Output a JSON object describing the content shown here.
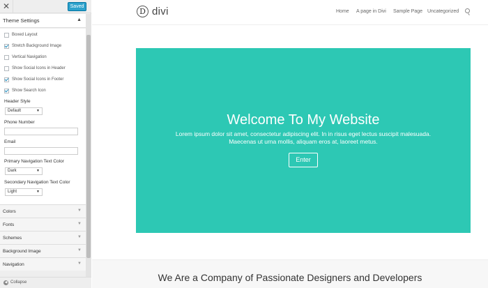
{
  "sidebar": {
    "close_icon": "✕",
    "saved_label": "Saved",
    "panel_title": "Theme Settings",
    "panel_arrow": "▲",
    "checkboxes": [
      {
        "label": "Boxed Layout",
        "checked": false
      },
      {
        "label": "Stretch Background Image",
        "checked": true
      },
      {
        "label": "Vertical Navigation",
        "checked": false
      },
      {
        "label": "Show Social Icons in Header",
        "checked": false
      },
      {
        "label": "Show Social Icons in Footer",
        "checked": true
      },
      {
        "label": "Show Search Icon",
        "checked": true
      }
    ],
    "header_style_label": "Header Style",
    "header_style_value": "Default",
    "phone_label": "Phone Number",
    "phone_value": "",
    "email_label": "Email",
    "email_value": "",
    "primary_nav_label": "Primary Navigation Text Color",
    "primary_nav_value": "Dark",
    "secondary_nav_label": "Secondary Navigation Text Color",
    "secondary_nav_value": "Light",
    "caret": "▼",
    "sections": [
      "Colors",
      "Fonts",
      "Schemes",
      "Background Image",
      "Navigation"
    ],
    "section_arrow": "▼",
    "collapse_label": "Collapse",
    "collapse_icon": "◀"
  },
  "site": {
    "logo_letter": "D",
    "logo_text": "divi",
    "nav": [
      "Home",
      "A page in Divi",
      "Sample Page",
      "Uncategorized"
    ],
    "hero_title": "Welcome To My Website",
    "hero_text_line1": "Lorem ipsum dolor sit amet, consectetur adipiscing elit. In in risus eget lectus suscipit malesuada.",
    "hero_text_line2": "Maecenas ut urna mollis, aliquam eros at, laoreet metus.",
    "hero_button": "Enter",
    "band_title": "We Are a Company of Passionate Designers and Developers"
  },
  "colors": {
    "accent": "#2ea2cc",
    "hero_bg": "#2dc8b4"
  }
}
